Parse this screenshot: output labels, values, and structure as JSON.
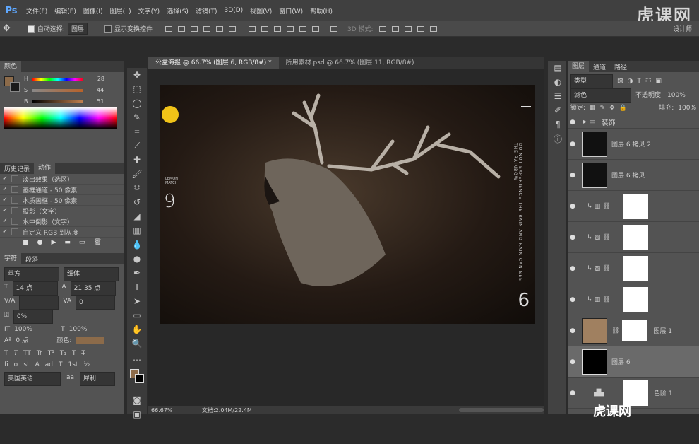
{
  "app": {
    "logo": "Ps",
    "brand": "虎课网"
  },
  "menu": [
    "文件(F)",
    "编辑(E)",
    "图像(I)",
    "图层(L)",
    "文字(Y)",
    "选择(S)",
    "滤镜(T)",
    "3D(D)",
    "视图(V)",
    "窗口(W)",
    "帮助(H)"
  ],
  "options": {
    "auto_select": "自动选择:",
    "auto_select_value": "图层",
    "show_transform": "显示变换控件",
    "mode3d": "3D 模式:",
    "workspace": "设计师"
  },
  "color_panel": {
    "tab": "颜色",
    "h_label": "H",
    "h_value": "28",
    "s_label": "S",
    "s_value": "44",
    "b_label": "B",
    "b_value": "51",
    "pct": "%"
  },
  "history_panel": {
    "tab1": "历史记录",
    "tab2": "动作",
    "items": [
      "淡出效果（选区）",
      "画框通道 - 50 像素",
      "木质画框 - 50 像素",
      "投影（文字）",
      "水中倒影（文字）",
      "自定义 RGB 到灰度"
    ]
  },
  "char_panel": {
    "tab1": "字符",
    "tab2": "段落",
    "font": "苹方",
    "style": "细体",
    "size": "14 点",
    "leading": "21.35 点",
    "kerning": "",
    "tracking": "0",
    "baseline": "0%",
    "vscale": "100%",
    "hscale": "100%",
    "shift": "0 点",
    "color_label": "颜色:",
    "lang": "美国英语",
    "aa": "犀利",
    "glyphs": [
      "T",
      "T",
      "TT",
      "Tr",
      "T¹",
      "T₁",
      "T",
      "T̶"
    ],
    "ot": [
      "fi",
      "σ",
      "st",
      "A",
      "ad",
      "T",
      "1st",
      "½"
    ]
  },
  "doc": {
    "tab1": "公益海报 @ 66.7% (图层 6, RGB/8#) *",
    "tab2": "所用素材.psd @ 66.7% (图层 11, RGB/8#)",
    "zoom": "66.67%",
    "status": "文档:2.04M/22.4M"
  },
  "poster": {
    "num_left": "9",
    "num_right": "6",
    "side_text": "DO NOT EXPERIENCE THE RAIN AND RAIN CAN SEE THE RAINBOW",
    "badge": "LEMON",
    "small": "LEMON MATCH"
  },
  "layers_panel": {
    "tab1": "图层",
    "tab2": "通道",
    "tab3": "路径",
    "filter": "类型",
    "blend": "滤色",
    "opacity_label": "不透明度:",
    "opacity": "100%",
    "lock_label": "锁定:",
    "fill_label": "填充:",
    "fill": "100%",
    "rows": [
      "装饰",
      "图层 6 拷贝 2",
      "图层 6 拷贝",
      "",
      "",
      "",
      "",
      "图层 1",
      "图层 6",
      "色阶 1"
    ]
  },
  "watermark": "虎课网"
}
